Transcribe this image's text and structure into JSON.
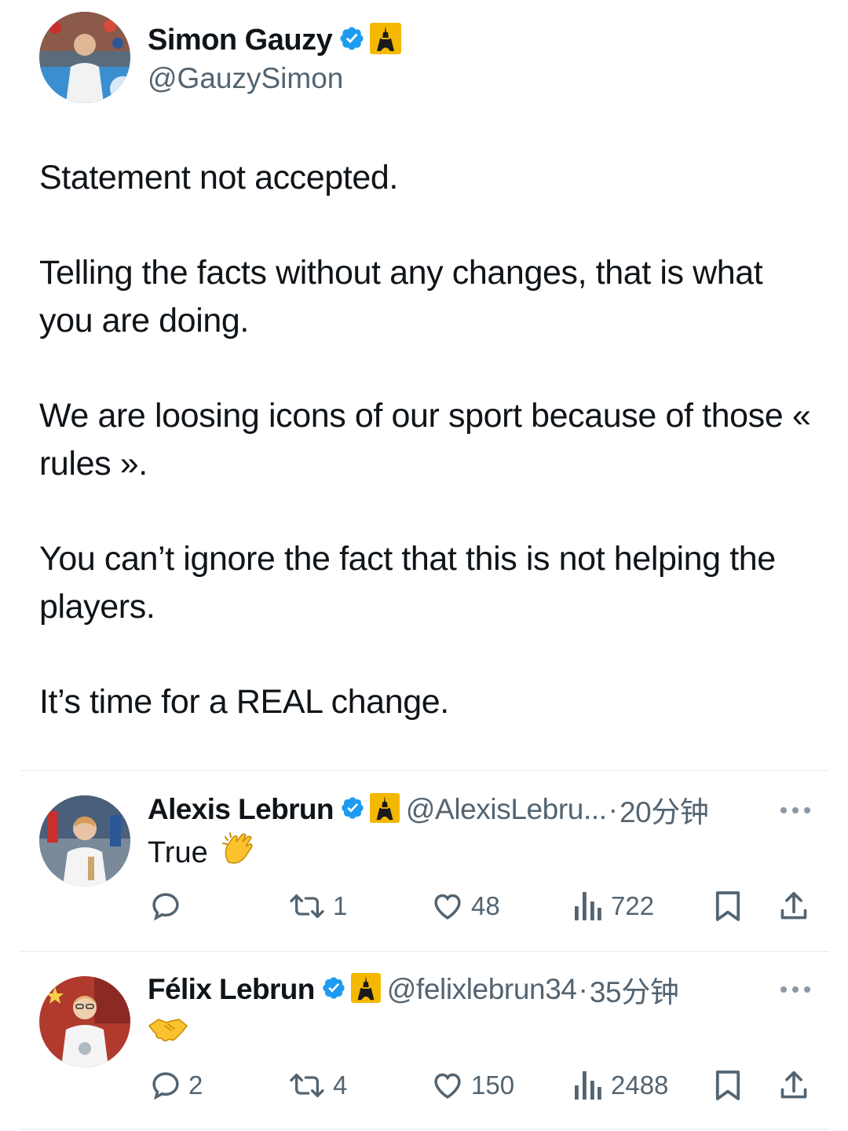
{
  "main_tweet": {
    "display_name": "Simon Gauzy",
    "handle": "@GauzySimon",
    "paragraphs": [
      "Statement not accepted.",
      "Telling the facts without any changes, that is what you are doing.",
      "We are loosing icons of our sport because of those « rules ».",
      "You can’t ignore the fact that this is not helping the players.",
      "It’s time for a REAL change."
    ]
  },
  "replies": [
    {
      "display_name": "Alexis Lebrun",
      "handle": "@AlexisLebru...",
      "separator": "·",
      "time": "20分钟",
      "text": "True",
      "emoji": "clapping-hands",
      "replies_count": "",
      "retweets": "1",
      "likes": "48",
      "views": "722"
    },
    {
      "display_name": "Félix Lebrun",
      "handle": "@felixlebrun34",
      "separator": "·",
      "time": "35分钟",
      "text": "",
      "emoji": "handshake",
      "replies_count": "2",
      "retweets": "4",
      "likes": "150",
      "views": "2488"
    }
  ],
  "icons": {
    "verified": "verified-badge-icon",
    "tower": "eiffel-tower-icon",
    "reply": "reply-icon",
    "retweet": "retweet-icon",
    "like": "heart-icon",
    "views": "views-icon",
    "bookmark": "bookmark-icon",
    "share": "share-icon",
    "more": "more-icon"
  },
  "colors": {
    "verified": "#1d9bf0",
    "tower_bg": "#f5b800",
    "text": "#0f1419",
    "secondary": "#536471"
  }
}
